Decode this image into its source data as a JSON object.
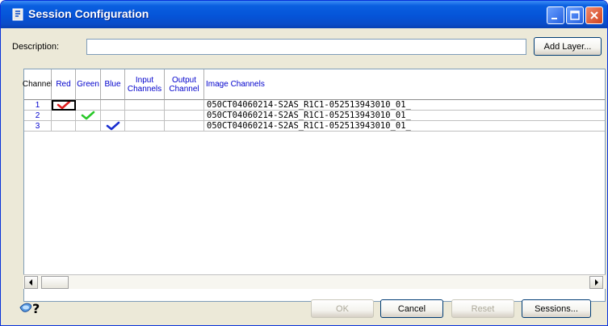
{
  "window": {
    "title": "Session Configuration"
  },
  "description": {
    "label": "Description:",
    "value": ""
  },
  "buttons": {
    "add_layer": "Add Layer...",
    "ok": "OK",
    "cancel": "Cancel",
    "reset": "Reset",
    "sessions": "Sessions..."
  },
  "grid": {
    "headers": {
      "channel": "Channel",
      "red": "Red",
      "green": "Green",
      "blue": "Blue",
      "input_channels": "Input Channels",
      "output_channel": "Output Channel",
      "image_channels": "Image Channels"
    },
    "rows": [
      {
        "channel": "1",
        "check": "red",
        "path": "050CT04060214-S2AS_R1C1-052513943010_01_"
      },
      {
        "channel": "2",
        "check": "green",
        "path": "050CT04060214-S2AS_R1C1-052513943010_01_"
      },
      {
        "channel": "3",
        "check": "blue",
        "path": "050CT04060214-S2AS_R1C1-052513943010_01_"
      }
    ]
  },
  "colors": {
    "check_red": "#e02020",
    "check_green": "#28c828",
    "check_blue": "#1a2fd0"
  },
  "icons": {
    "help": "help-icon"
  }
}
